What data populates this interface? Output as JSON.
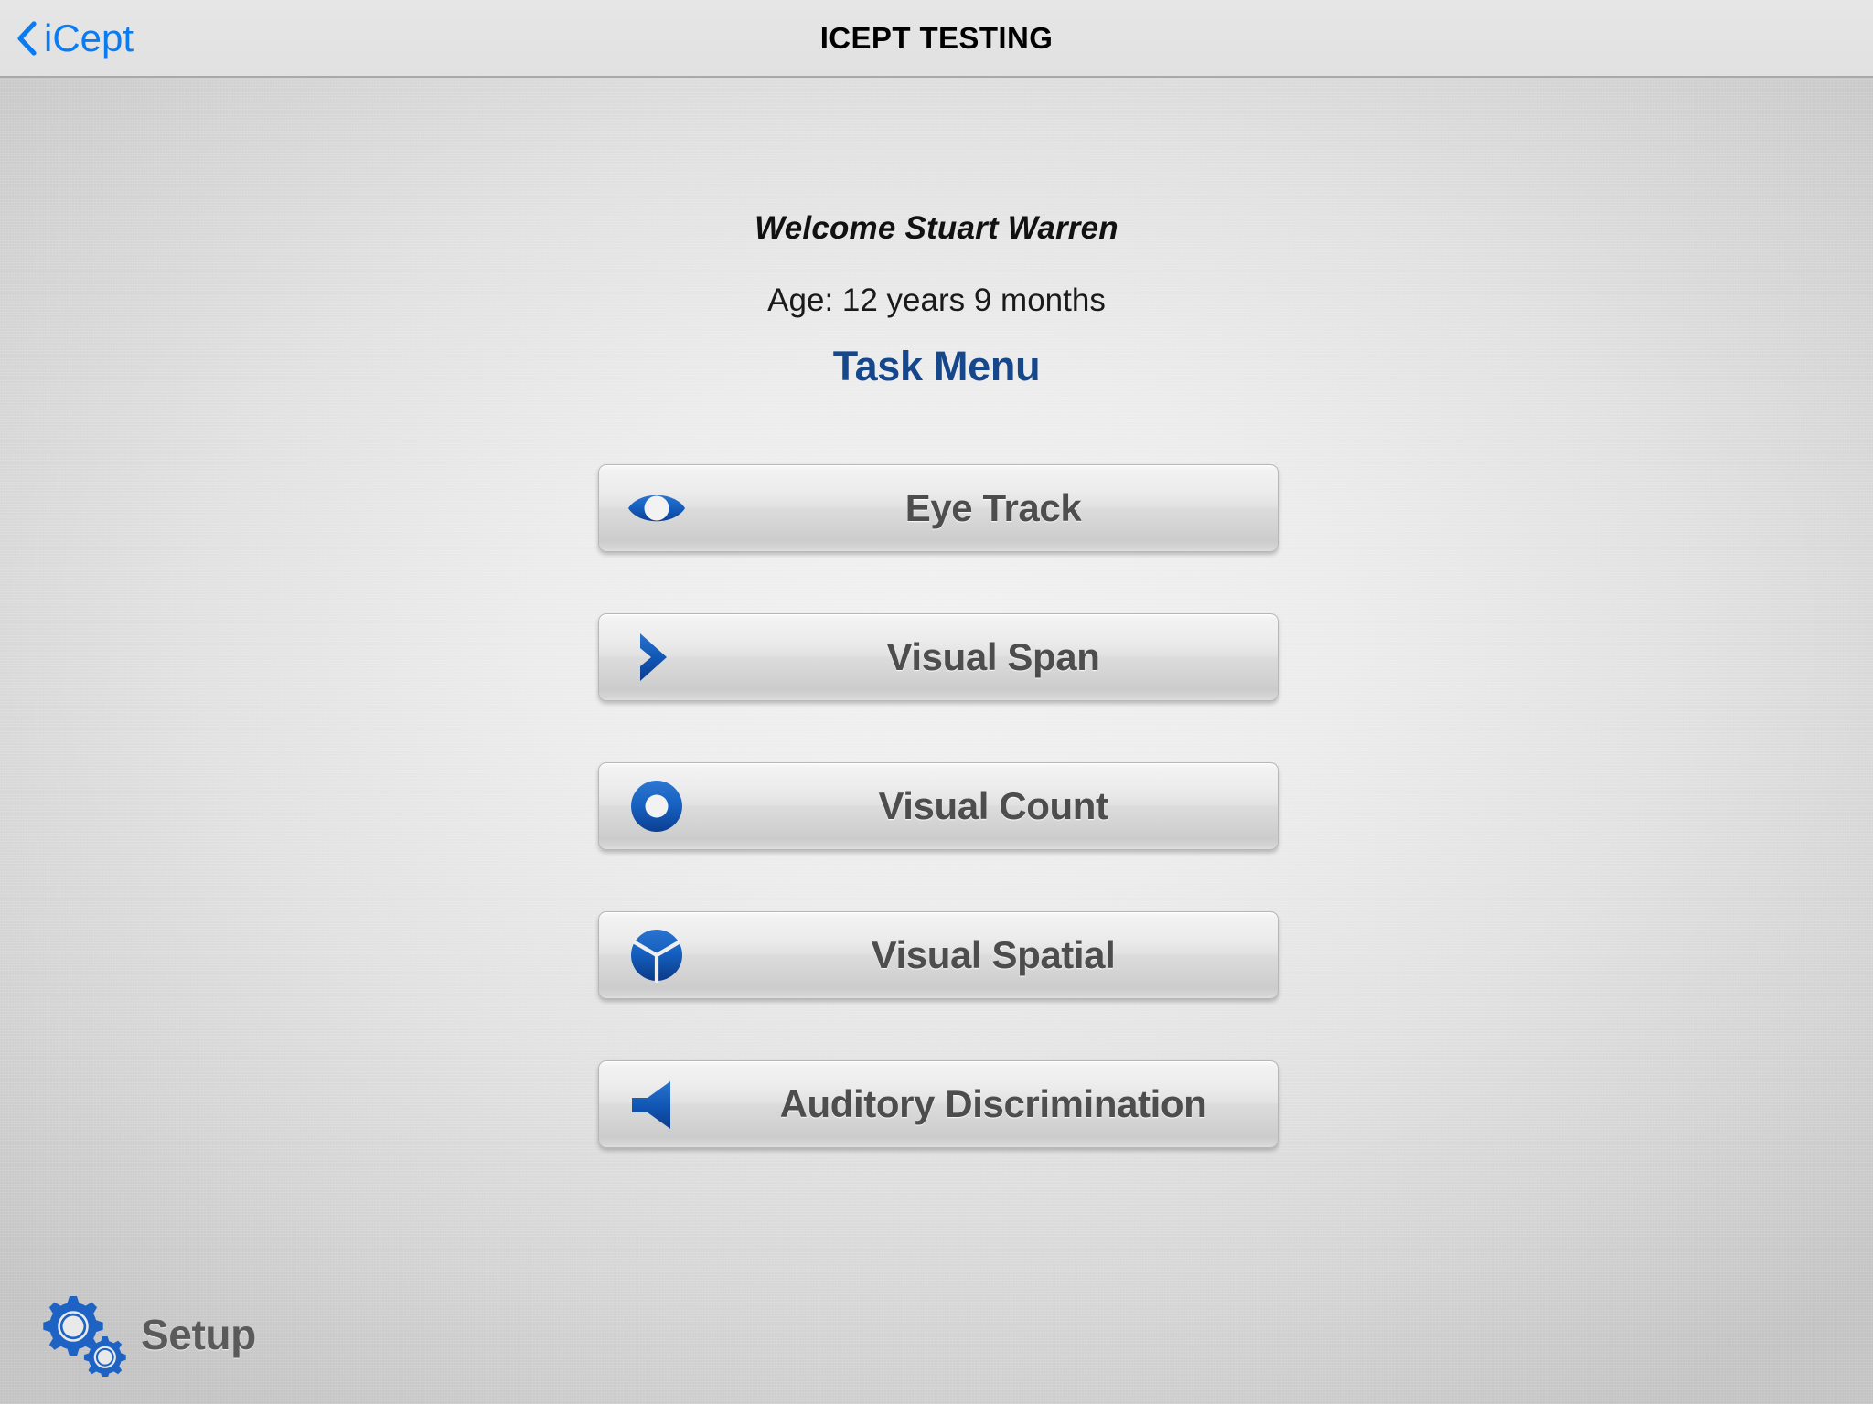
{
  "navbar": {
    "back_label": "iCept",
    "back_icon": "chevron-left-icon",
    "title": "ICEPT TESTING",
    "accent_color": "#0a7bf1",
    "background_color": "#e3e3e3"
  },
  "header": {
    "welcome": "Welcome Stuart Warren",
    "age": "Age: 12 years 9 months",
    "task_menu_heading": "Task Menu",
    "heading_color": "#16478a"
  },
  "tasks": [
    {
      "label": "Eye Track",
      "icon": "eye-icon"
    },
    {
      "label": "Visual Span",
      "icon": "chevron-right-icon"
    },
    {
      "label": "Visual Count",
      "icon": "circle-ring-icon"
    },
    {
      "label": "Visual Spatial",
      "icon": "cube-sphere-icon"
    },
    {
      "label": "Auditory Discrimination",
      "icon": "speaker-icon"
    }
  ],
  "setup": {
    "label": "Setup",
    "icon": "gears-icon",
    "icon_color": "#1e63c4"
  }
}
